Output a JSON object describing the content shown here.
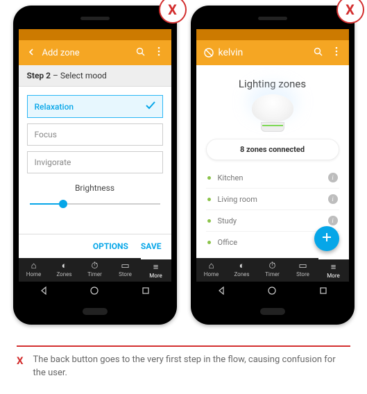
{
  "badge_marker": "X",
  "left": {
    "appbar_title": "Add zone",
    "step_label": "Step 2",
    "step_desc": " – Select mood",
    "options": [
      "Relaxation",
      "Focus",
      "Invigorate"
    ],
    "selected_option": "Relaxation",
    "slider_label": "Brightness",
    "slider_value_pct": 26,
    "actions": {
      "options": "OPTIONS",
      "save": "SAVE"
    }
  },
  "right": {
    "brand": "kelvin",
    "hero_title": "Lighting zones",
    "pill_text": "8 zones connected",
    "zones": [
      "Kitchen",
      "Living room",
      "Study",
      "Office"
    ]
  },
  "tabs": [
    {
      "icon": "home-icon",
      "glyph": "⌂",
      "label": "Home"
    },
    {
      "icon": "bulb-icon",
      "glyph": "◐",
      "label": "Zones"
    },
    {
      "icon": "timer-icon",
      "glyph": "⏱",
      "label": "Timer"
    },
    {
      "icon": "store-icon",
      "glyph": "▭",
      "label": "Store"
    },
    {
      "icon": "more-icon",
      "glyph": "≡",
      "label": "More"
    }
  ],
  "caption": "The back button goes to the very first step in the flow, causing confusion for the user."
}
